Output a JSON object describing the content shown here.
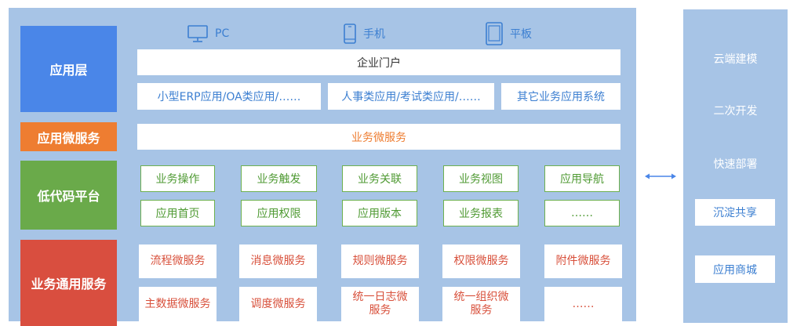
{
  "layers": {
    "app": "应用层",
    "micro": "应用微服务",
    "lowcode": "低代码平台",
    "common": "业务通用服务"
  },
  "devices": {
    "pc": "PC",
    "phone": "手机",
    "tablet": "平板"
  },
  "app_layer": {
    "portal": "企业门户",
    "apps": [
      "小型ERP应用/OA类应用/……",
      "人事类应用/考试类应用/……",
      "其它业务应用系统"
    ]
  },
  "micro_layer": {
    "service": "业务微服务"
  },
  "lowcode_items": [
    [
      "业务操作",
      "业务触发",
      "业务关联",
      "业务视图",
      "应用导航"
    ],
    [
      "应用首页",
      "应用权限",
      "应用版本",
      "业务报表",
      "……"
    ]
  ],
  "common_items": [
    [
      "流程微服务",
      "消息微服务",
      "规则微服务",
      "权限微服务",
      "附件微服务"
    ],
    [
      "主数据微服务",
      "调度微服务",
      "统一日志微服务",
      "统一组织微服务",
      "……"
    ]
  ],
  "right_panel": {
    "items": [
      "云端建模",
      "二次开发",
      "快速部署"
    ],
    "boxes": [
      "沉淀共享",
      "应用商城"
    ]
  },
  "colors": {
    "panel": "#a7c4e6",
    "app_layer": "#4a86e8",
    "micro_layer": "#ee7d31",
    "lowcode_layer": "#6aaa4a",
    "common_layer": "#d94e3f"
  }
}
